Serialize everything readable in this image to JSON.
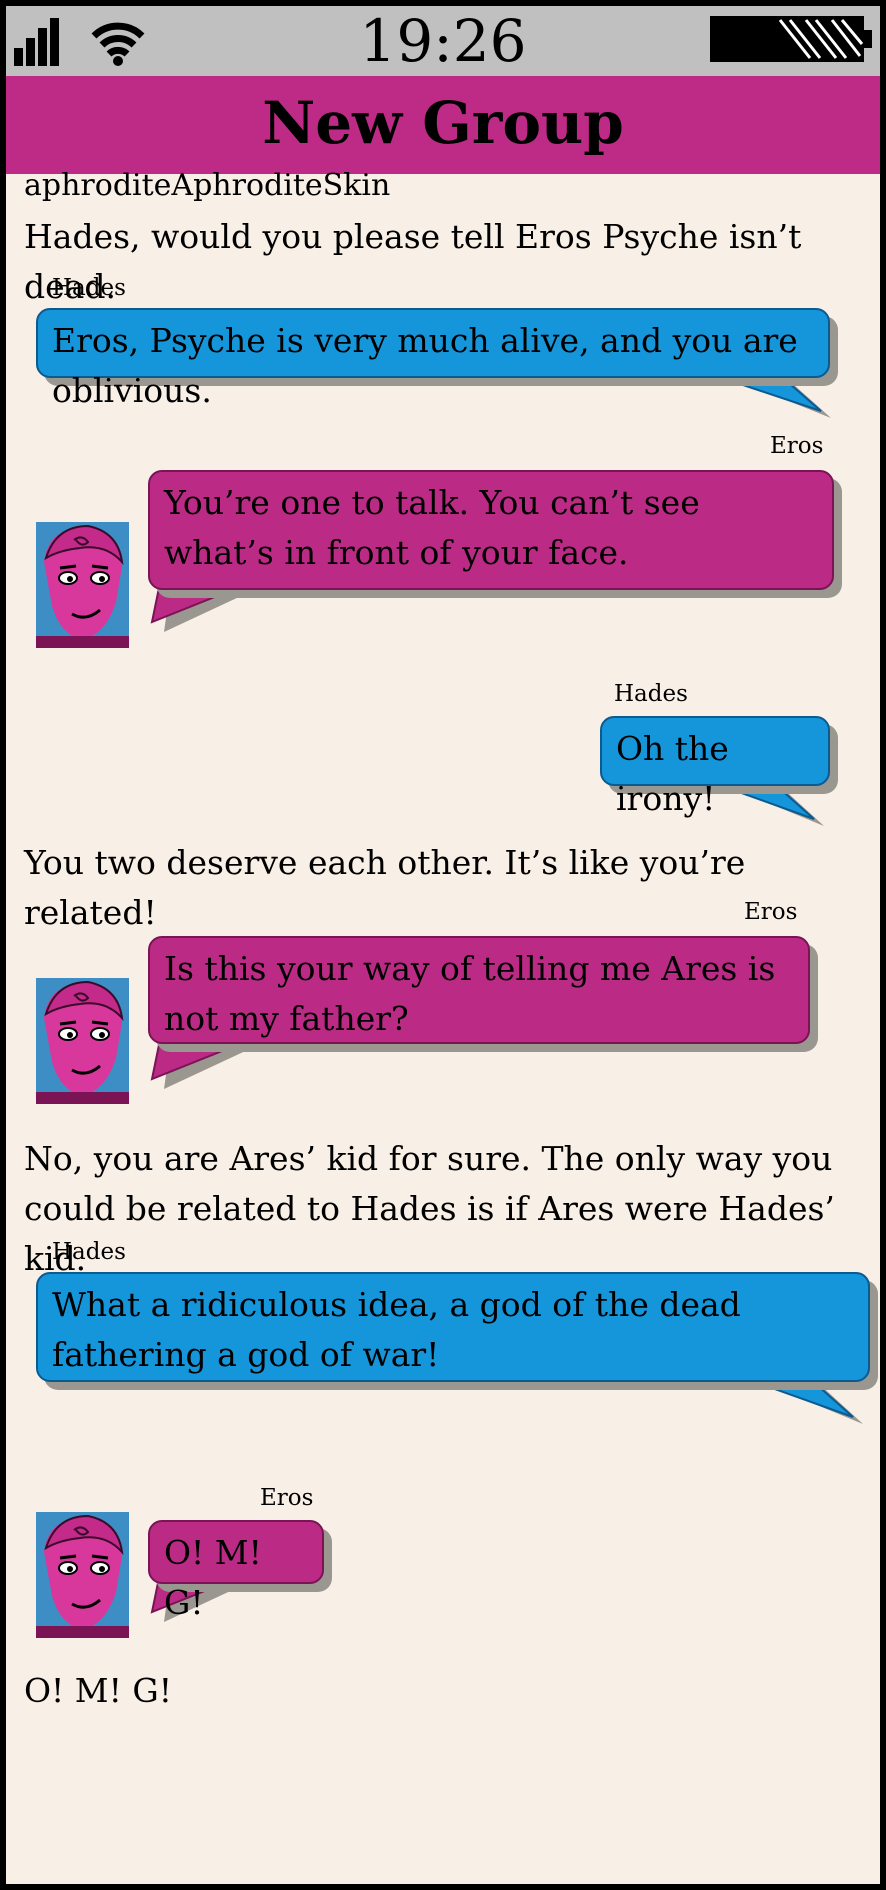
{
  "status": {
    "time": "19:26",
    "icons": [
      "signal-icon",
      "wifi-icon",
      "battery-icon"
    ]
  },
  "header": {
    "title": "New Group"
  },
  "colors": {
    "header": "#bd2b86",
    "blue_bubble": "#1596db",
    "pink_bubble": "#bb2b85",
    "background": "#f8efe6"
  },
  "chat": {
    "sender_top": "aphroditeAphroditeSkin",
    "m1": "Hades, would you please tell Eros Psyche isn’t dead.",
    "m2_sender": "Hades",
    "m2": "Eros, Psyche is very much alive, and you are oblivious.",
    "m3_sender": "Eros",
    "m3": "You’re one to talk. You can’t see what’s in front of your face.",
    "m4_sender": "Hades",
    "m4": "Oh the irony!",
    "m5": "You two deserve each other. It’s like you’re related!",
    "m6_sender": "Eros",
    "m6": "Is this your way of telling me Ares is not my father?",
    "m7": "No, you are Ares’ kid for sure. The only way you could be related to Hades is if Ares were Hades’ kid.",
    "m8_sender": "Hades",
    "m8": "What a ridiculous idea, a god of the dead fathering a god of war!",
    "m9_sender": "Eros",
    "m9": "O! M! G!",
    "m10": "O! M! G!"
  }
}
